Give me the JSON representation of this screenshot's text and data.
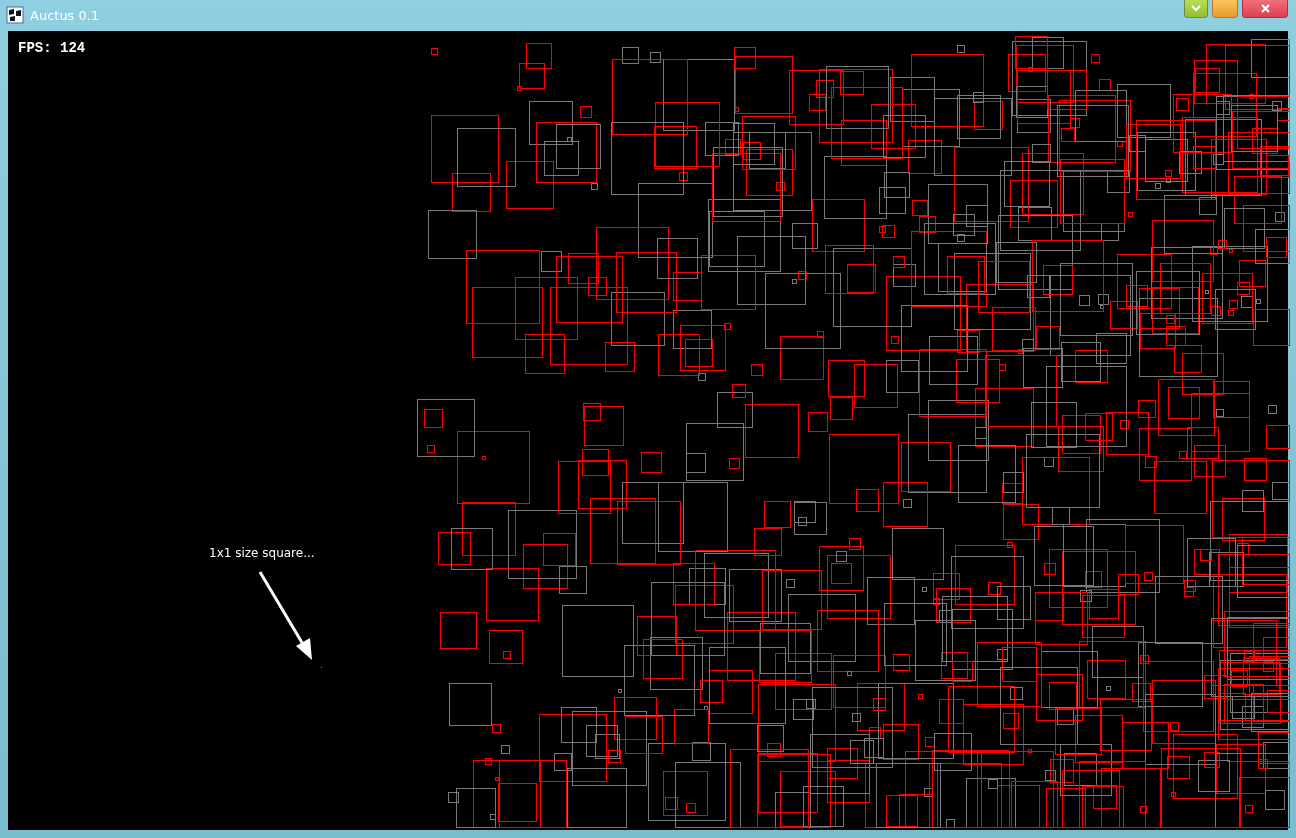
{
  "window": {
    "title": "Auctus 0.1"
  },
  "canvas": {
    "fps": "FPS: 124",
    "annotation": "1x1 size square..."
  }
}
